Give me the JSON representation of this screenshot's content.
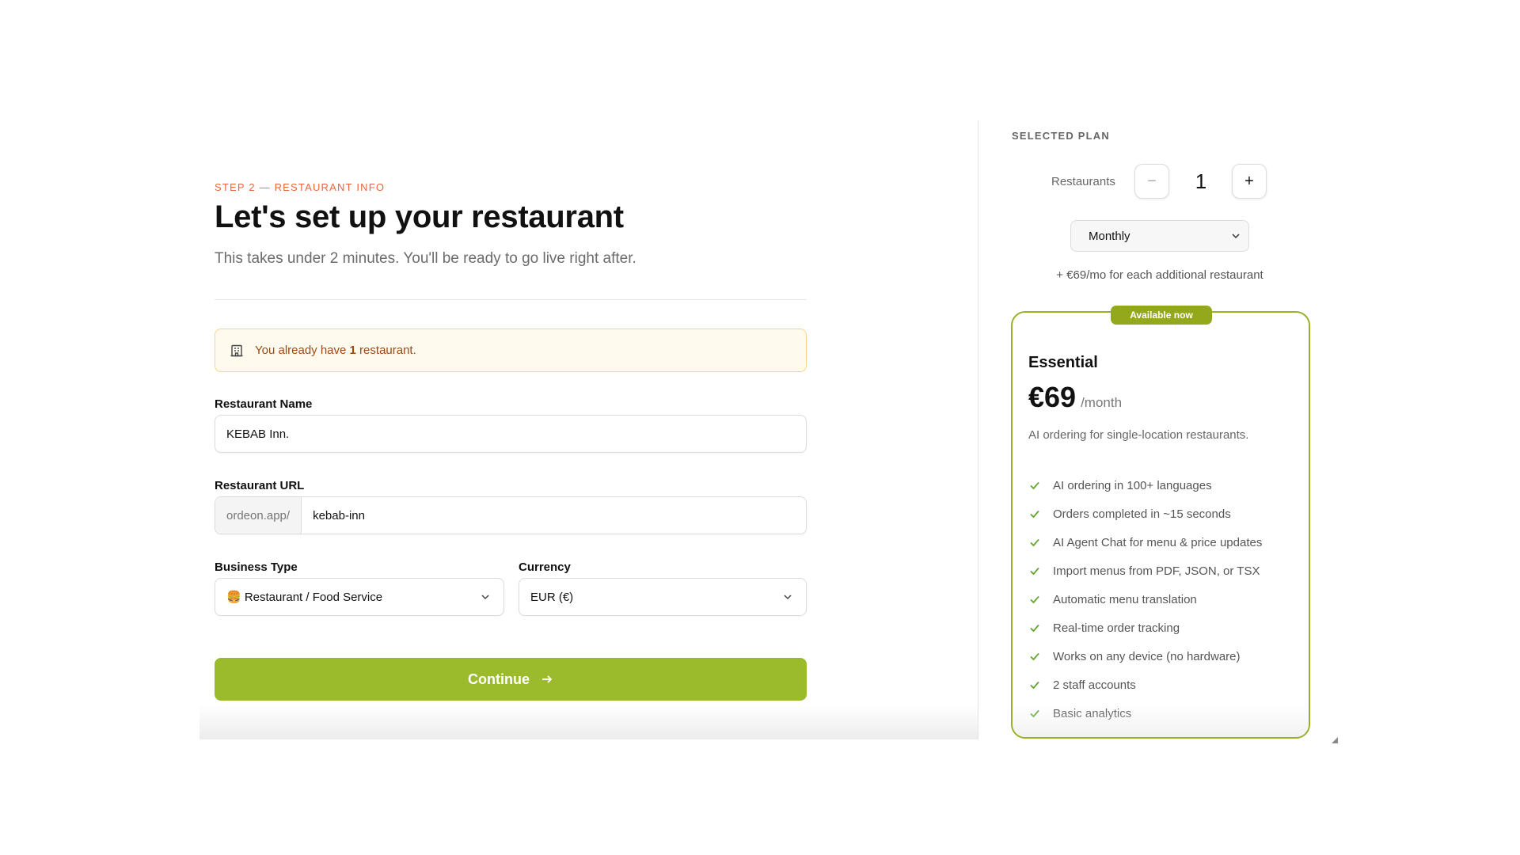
{
  "form": {
    "step_label": "STEP 2 — RESTAURANT INFO",
    "title": "Let's set up your restaurant",
    "subtitle": "This takes under 2 minutes. You'll be ready to go live right after.",
    "notice": {
      "prefix": "You already have ",
      "count": "1",
      "suffix": " restaurant.",
      "icon": "building-icon"
    },
    "restaurant_name": {
      "label": "Restaurant Name",
      "value": "KEBAB Inn."
    },
    "restaurant_url": {
      "label": "Restaurant URL",
      "prefix": "ordeon.app/",
      "value": "kebab-inn"
    },
    "business_type": {
      "label": "Business Type",
      "value": "🍔 Restaurant / Food Service"
    },
    "currency": {
      "label": "Currency",
      "value": "EUR (€)"
    },
    "continue_label": "Continue"
  },
  "plan": {
    "section_label": "SELECTED PLAN",
    "restaurants_label": "Restaurants",
    "minus_label": "−",
    "plus_label": "+",
    "restaurant_count": "1",
    "billing_period": "Monthly",
    "additional_note": "+ €69/mo for each additional restaurant",
    "badge": "Available now",
    "name": "Essential",
    "price": "€69",
    "period": "/month",
    "description": "AI ordering for single-location restaurants.",
    "features": [
      "AI ordering in 100+ languages",
      "Orders completed in ~15 seconds",
      "AI Agent Chat for menu & price updates",
      "Import menus from PDF, JSON, or TSX",
      "Automatic menu translation",
      "Real-time order tracking",
      "Works on any device (no hardware)",
      "2 staff accounts",
      "Basic analytics"
    ]
  },
  "colors": {
    "accent_green": "#9cbb2c",
    "step_orange": "#e8663b",
    "notice_bg": "#fefbee",
    "notice_border": "#f5d58a",
    "check_green": "#5fa830"
  }
}
